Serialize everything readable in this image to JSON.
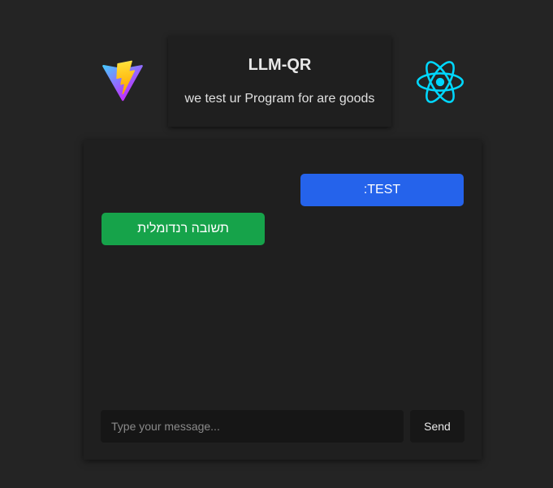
{
  "header": {
    "title": "LLM-QR",
    "subtitle": "we test ur Program for are goods",
    "left_logo": "vite-logo-icon",
    "right_logo": "react-logo-icon"
  },
  "chat": {
    "messages": [
      {
        "role": "user",
        "text": "TEST:",
        "color": "#2563eb"
      },
      {
        "role": "bot",
        "text": "תשובה רנדומלית",
        "color": "#16a34a"
      }
    ],
    "input": {
      "value": "",
      "placeholder": "Type your message..."
    },
    "send_label": "Send"
  },
  "colors": {
    "background": "#242424",
    "card": "#1f1f1f",
    "user_bubble": "#2563eb",
    "bot_bubble": "#16a34a",
    "react_accent": "#00d8ff"
  }
}
